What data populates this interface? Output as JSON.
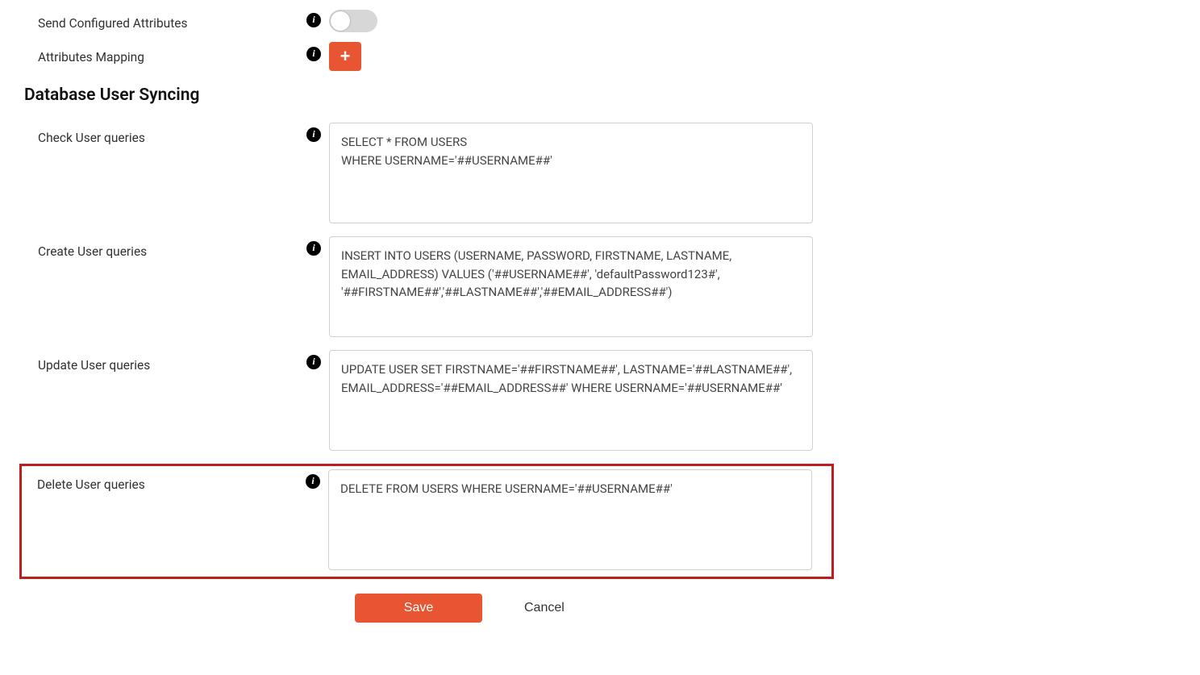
{
  "fields": {
    "send_configured_attributes": {
      "label": "Send Configured Attributes"
    },
    "attributes_mapping": {
      "label": "Attributes Mapping"
    }
  },
  "section": {
    "title": "Database User Syncing"
  },
  "queries": {
    "check": {
      "label": "Check User queries",
      "value": "SELECT * FROM USERS\nWHERE USERNAME='##USERNAME##'"
    },
    "create": {
      "label": "Create User queries",
      "value": "INSERT INTO USERS (USERNAME, PASSWORD, FIRSTNAME, LASTNAME, EMAIL_ADDRESS) VALUES ('##USERNAME##', 'defaultPassword123#', '##FIRSTNAME##','##LASTNAME##','##EMAIL_ADDRESS##')"
    },
    "update": {
      "label": "Update User queries",
      "value": "UPDATE USER SET FIRSTNAME='##FIRSTNAME##', LASTNAME='##LASTNAME##', EMAIL_ADDRESS='##EMAIL_ADDRESS##' WHERE USERNAME='##USERNAME##'"
    },
    "delete": {
      "label": "Delete User queries",
      "value": "DELETE FROM USERS WHERE USERNAME='##USERNAME##'"
    }
  },
  "buttons": {
    "save": "Save",
    "cancel": "Cancel"
  },
  "icons": {
    "info": "i",
    "plus": "+"
  }
}
